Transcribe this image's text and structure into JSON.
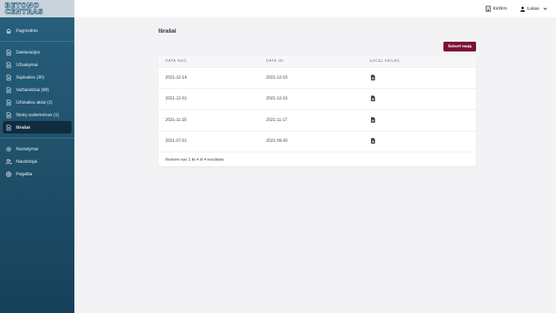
{
  "brand": {
    "line1": "BETONO",
    "line2": "CENTRAS"
  },
  "topbar": {
    "company": "Kinfirm",
    "user": "Lukas"
  },
  "sidebar": {
    "items": [
      {
        "label": "Pagrindinis",
        "icon": "home-icon",
        "active": false
      },
      {
        "label": "Deklaracijos",
        "icon": "document-icon",
        "active": false
      },
      {
        "label": "Užsakymai",
        "icon": "document-icon",
        "active": false
      },
      {
        "label": "Sąskaitos (30)",
        "icon": "document-icon",
        "active": false
      },
      {
        "label": "Važtaraščiai (69)",
        "icon": "document-icon",
        "active": false
      },
      {
        "label": "Užskaitos aktai (2)",
        "icon": "document-icon",
        "active": false
      },
      {
        "label": "Skolų suderinimas (1)",
        "icon": "document-icon",
        "active": false
      },
      {
        "label": "Išrašai",
        "icon": "document-icon",
        "active": true
      },
      {
        "label": "Nustatymai",
        "icon": "gear-icon",
        "active": false
      },
      {
        "label": "Naudotojai",
        "icon": "users-icon",
        "active": false
      },
      {
        "label": "Pagalba",
        "icon": "help-icon",
        "active": false
      }
    ]
  },
  "main": {
    "title": "Išrašai",
    "new_button": "Suburti naują",
    "table": {
      "headers": [
        "DATA NUO",
        "DATA IKI",
        "EXCEL FAILAS"
      ],
      "rows": [
        {
          "from": "2021-12-14",
          "to": "2021-12-15"
        },
        {
          "from": "2021-12-01",
          "to": "2021-12-15"
        },
        {
          "from": "2021-11-15",
          "to": "2021-11-17"
        },
        {
          "from": "2021-07-01",
          "to": "2021-09-30"
        }
      ],
      "footer": "Rodomi nuo 1 iki 4 iš 4 rezultatai"
    }
  },
  "colors": {
    "sidebar": "#1f4f69",
    "active_item": "#0f2d3f",
    "accent_button": "#7b1236",
    "background": "#f3f3f5"
  }
}
